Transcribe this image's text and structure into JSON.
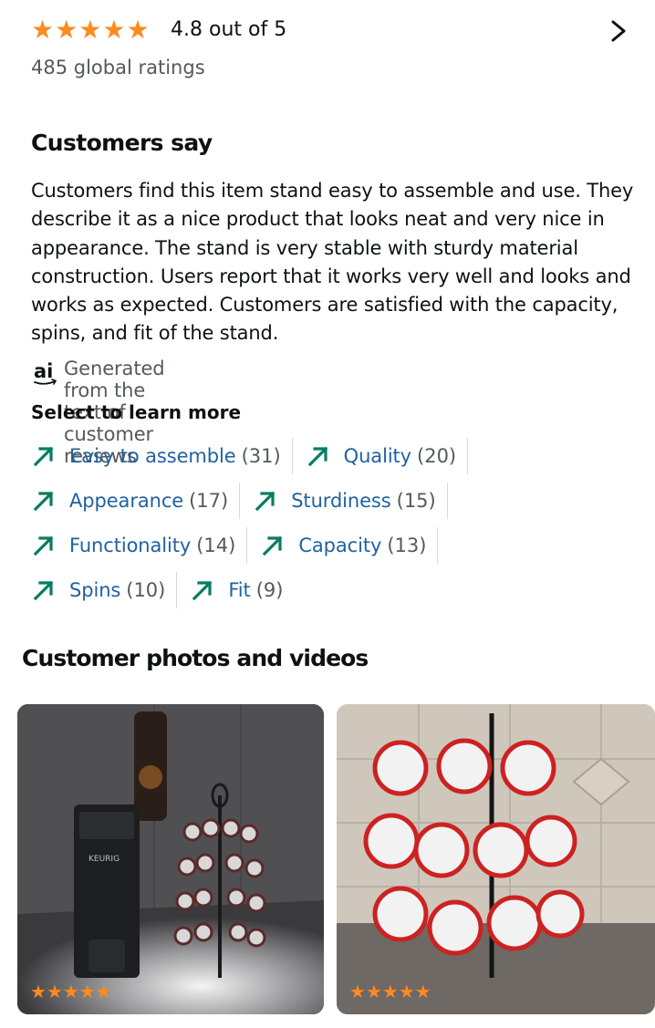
{
  "ratings": {
    "rating_text": "4.8 out of 5",
    "global_ratings": "485 global ratings",
    "stars": 4.8,
    "stars_icon": "star-filled"
  },
  "customers_say": {
    "title": "Customers say",
    "summary": "Customers find this item stand easy to assemble and use. They describe it as a nice product that looks neat and very nice in appearance. The stand is very stable with sturdy material construction. Users report that it works very well and looks and works as expected. Customers are satisfied with the capacity, spins, and fit of the stand.",
    "ai_logo_text": "ai",
    "ai_note": "Generated from the text of customer reviews"
  },
  "learn_more": {
    "title": "Select to learn more",
    "chips": [
      {
        "label": "Easy to assemble",
        "count": "(31)"
      },
      {
        "label": "Quality",
        "count": "(20)"
      },
      {
        "label": "Appearance",
        "count": "(17)"
      },
      {
        "label": "Sturdiness",
        "count": "(15)"
      },
      {
        "label": "Functionality",
        "count": "(14)"
      },
      {
        "label": "Capacity",
        "count": "(13)"
      },
      {
        "label": "Spins",
        "count": "(10)"
      },
      {
        "label": "Fit",
        "count": "(9)"
      }
    ]
  },
  "photos": {
    "title": "Customer photos and videos",
    "items": [
      {
        "stars": 5,
        "brand_text": "KEURIG"
      },
      {
        "stars": 5
      }
    ]
  },
  "colors": {
    "star": "#ff8a1f",
    "link": "#2162a1",
    "trend_arrow": "#067d62",
    "muted": "#565959"
  }
}
